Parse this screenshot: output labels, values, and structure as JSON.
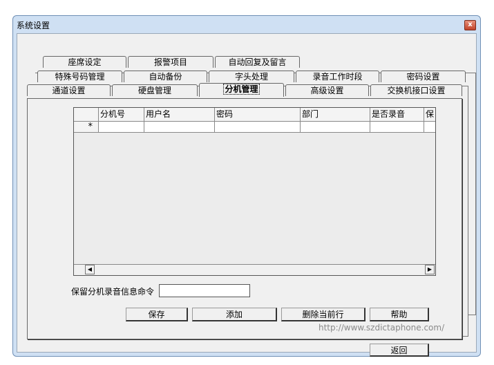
{
  "window": {
    "title": "系统设置",
    "close_label": "x"
  },
  "tabs": {
    "row1": [
      "座席设定",
      "报警项目",
      "自动回复及留言"
    ],
    "row2": [
      "特殊号码管理",
      "自动备份",
      "字头处理",
      "录音工作时段",
      "密码设置"
    ],
    "row3": [
      "通道设置",
      "硬盘管理",
      "分机管理",
      "高级设置",
      "交换机接口设置"
    ],
    "active": "分机管理"
  },
  "grid": {
    "columns": [
      "分机号",
      "用户名",
      "密码",
      "部门",
      "是否录音",
      "保"
    ],
    "new_row_marker": "*"
  },
  "form": {
    "command_label": "保留分机录音信息命令",
    "command_value": ""
  },
  "buttons": {
    "save": "保存",
    "add": "添加",
    "delete_row": "删除当前行",
    "help": "帮助",
    "back": "返回"
  },
  "watermark": "http://www.szdictaphone.com/"
}
